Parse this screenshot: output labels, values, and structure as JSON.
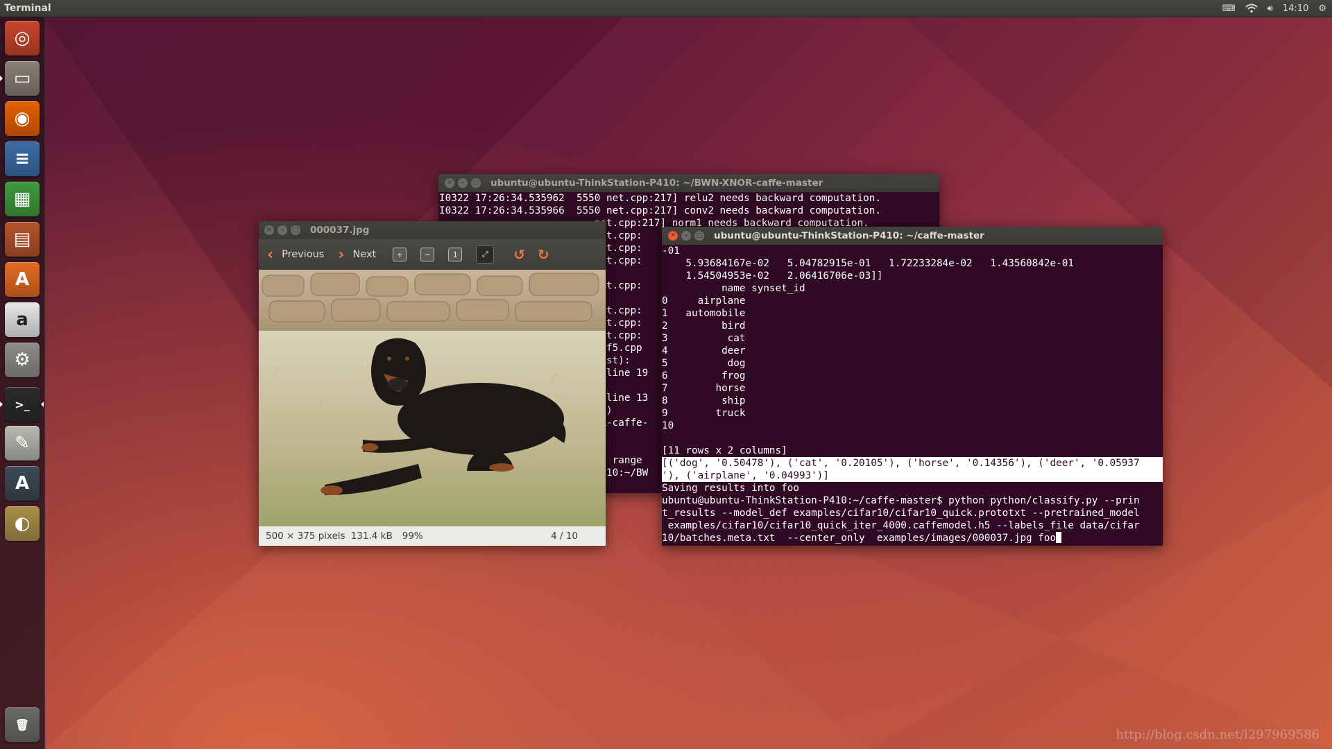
{
  "top_panel": {
    "app_title": "Terminal",
    "clock": "14:10",
    "indicators": [
      "keyboard-icon",
      "wifi-icon",
      "volume-icon",
      "settings-icon"
    ]
  },
  "launcher": {
    "items": [
      {
        "name": "ubuntu-dash",
        "icon": "ubuntu-logo-icon",
        "glyph": "◎",
        "color": "#c8462c"
      },
      {
        "name": "files",
        "icon": "file-cabinet-icon",
        "glyph": "▭",
        "color": "#8a7f74"
      },
      {
        "name": "firefox",
        "icon": "firefox-icon",
        "glyph": "◉",
        "color": "#e66000"
      },
      {
        "name": "libreoffice-writer",
        "icon": "writer-document-icon",
        "glyph": "≡",
        "color": "#3c6ea8"
      },
      {
        "name": "libreoffice-calc",
        "icon": "calc-spreadsheet-icon",
        "glyph": "▦",
        "color": "#3f9a3c"
      },
      {
        "name": "libreoffice-impress",
        "icon": "impress-presentation-icon",
        "glyph": "▤",
        "color": "#b5542a"
      },
      {
        "name": "software-center",
        "icon": "shopping-bag-icon",
        "glyph": "A",
        "color": "#e46b22"
      },
      {
        "name": "amazon",
        "icon": "amazon-icon",
        "glyph": "a",
        "color": "#e9e9e9"
      },
      {
        "name": "system-settings",
        "icon": "wrench-gear-icon",
        "glyph": "⚙",
        "color": "#8f8d89"
      },
      {
        "name": "terminal",
        "icon": "terminal-icon",
        "glyph": ">_",
        "color": "#2b2b2b"
      },
      {
        "name": "text-editor",
        "icon": "text-editor-icon",
        "glyph": "✎",
        "color": "#b8b8b0"
      },
      {
        "name": "software-updater",
        "icon": "updater-icon",
        "glyph": "A",
        "color": "#3d4a55"
      },
      {
        "name": "image-viewer",
        "icon": "image-viewer-icon",
        "glyph": "◐",
        "color": "#a8904a"
      },
      {
        "name": "trash",
        "icon": "trash-icon",
        "glyph": "🗑",
        "color": "#6c6a66"
      }
    ]
  },
  "back_terminal": {
    "title": "ubuntu@ubuntu-ThinkStation-P410: ~/BWN-XNOR-caffe-master",
    "lines": [
      "I0322 17:26:34.535962  5550 net.cpp:217] relu2 needs backward computation.",
      "I0322 17:26:34.535966  5550 net.cpp:217] conv2 needs backward computation.",
      "                          net.cpp:217] norm1 needs backward computation.",
      "                          net.cpp:",
      "                          net.cpp:",
      "                          net.cpp:",
      "",
      "                          net.cpp:",
      "",
      "                          net.cpp:",
      "                          net.cpp:",
      "                          net.cpp:",
      "                          hdf5.cpp",
      "                          last):",
      "                          , line 19",
      "",
      "                          , line 13",
      "                          ap)",
      "                          OR-caffe-",
      "",
      "",
      "                          of range",
      "                          P410:~/BW"
    ]
  },
  "image_viewer": {
    "title": "000037.jpg",
    "previous_label": "Previous",
    "next_label": "Next",
    "status_dims": "500 × 375 pixels",
    "status_size": "131.4 kB",
    "status_zoom": "99%",
    "status_position": "4 / 10"
  },
  "front_terminal": {
    "title": "ubuntu@ubuntu-ThinkStation-P410: ~/caffe-master",
    "lines_before": [
      "-01",
      "    5.93684167e-02   5.04782915e-01   1.72233284e-02   1.43560842e-01",
      "    1.54504953e-02   2.06416706e-03]]",
      "          name synset_id",
      "0     airplane",
      "1   automobile",
      "2         bird",
      "3          cat",
      "4         deer",
      "5          dog",
      "6         frog",
      "7        horse",
      "8         ship",
      "9        truck",
      "10",
      "",
      "[11 rows x 2 columns]"
    ],
    "selected_lines": [
      "[('dog', '0.50478'), ('cat', '0.20105'), ('horse', '0.14356'), ('deer', '0.05937",
      "'), ('airplane', '0.04993')]"
    ],
    "lines_after": [
      "Saving results into foo",
      "ubuntu@ubuntu-ThinkStation-P410:~/caffe-master$ python python/classify.py --prin",
      "t_results --model_def examples/cifar10/cifar10_quick.prototxt --pretrained_model",
      " examples/cifar10/cifar10_quick_iter_4000.caffemodel.h5 --labels_file data/cifar",
      "10/batches.meta.txt  --center_only  examples/images/000037.jpg foo"
    ]
  },
  "watermark": "http://blog.csdn.net/l297969586"
}
